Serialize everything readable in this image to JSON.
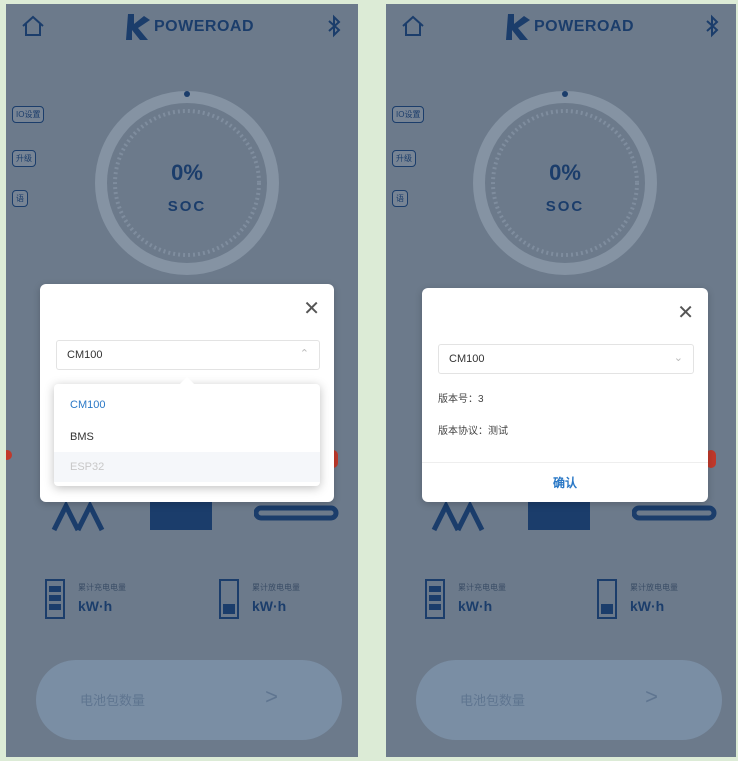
{
  "colors": {
    "brand": "#1b3d6b",
    "overlay_bg": "#6c7a8b",
    "accent_blue": "#2a78c6",
    "outer_bg": "#dcebd6",
    "alert_red": "#c0392b"
  },
  "header": {
    "brand_name": "POWEROAD",
    "home_icon": "home-icon",
    "bluetooth_icon": "bluetooth-icon"
  },
  "side_buttons": [
    {
      "label": "IO设置"
    },
    {
      "label": "升级"
    },
    {
      "label": "语"
    }
  ],
  "gauge": {
    "soc_value": "0%",
    "soc_label": "SOC",
    "soc_fraction": 0
  },
  "stats": [
    {
      "title": "累计充电电量",
      "unit": "kW·h"
    },
    {
      "title": "累计放电电量",
      "unit": "kW·h"
    }
  ],
  "bottom_button": {
    "label": "电池包数量",
    "arrow": ">"
  },
  "modal_left": {
    "close": "✕",
    "selected": "CM100",
    "arrow": "⌃",
    "options": [
      {
        "label": "CM100",
        "state": "selected"
      },
      {
        "label": "BMS",
        "state": "normal"
      },
      {
        "label": "ESP32",
        "state": "disabled"
      }
    ]
  },
  "modal_right": {
    "close": "✕",
    "selected": "CM100",
    "arrow": "⌄",
    "version_line": "版本号：3",
    "protocol_line": "版本协议：测试",
    "confirm": "确认"
  }
}
